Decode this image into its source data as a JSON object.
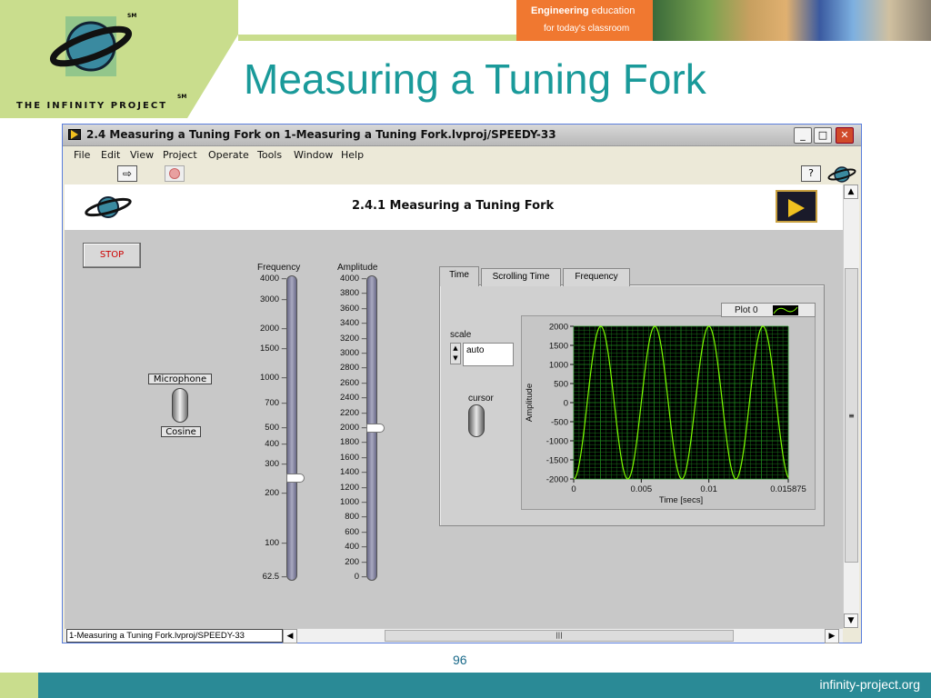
{
  "slide": {
    "title": "Measuring a Tuning Fork",
    "logo_text": "THE INFINITY PROJECT",
    "sm": "SM",
    "brand_engineering": "Engineering",
    "brand_education": "education",
    "brand_tagline": "for today's classroom",
    "page_number": "96",
    "footer_url": "infinity-project.org"
  },
  "window": {
    "title": "2.4 Measuring a Tuning Fork on 1-Measuring a Tuning Fork.lvproj/SPEEDY-33",
    "menu": [
      "File",
      "Edit",
      "View",
      "Project",
      "Operate",
      "Tools",
      "Window",
      "Help"
    ],
    "vi_title": "2.4.1 Measuring a Tuning Fork",
    "status_path": "1-Measuring a Tuning Fork.lvproj/SPEEDY-33"
  },
  "controls": {
    "stop_label": "STOP",
    "source_switch": {
      "top_label": "Microphone",
      "bottom_label": "Cosine"
    },
    "frequency": {
      "label": "Frequency",
      "ticks": [
        "4000",
        "3000",
        "2000",
        "1500",
        "1000",
        "700",
        "500",
        "400",
        "300",
        "200",
        "100",
        "62.5"
      ],
      "value": 250
    },
    "amplitude": {
      "label": "Amplitude",
      "ticks": [
        "4000",
        "3800",
        "3600",
        "3400",
        "3200",
        "3000",
        "2800",
        "2600",
        "2400",
        "2200",
        "2000",
        "1800",
        "1600",
        "1400",
        "1200",
        "1000",
        "800",
        "600",
        "400",
        "200",
        "0"
      ],
      "value": 2000
    },
    "tabs": [
      "Time",
      "Scrolling Time",
      "Frequency"
    ],
    "active_tab": "Time",
    "scale_label": "scale",
    "scale_value": "auto",
    "cursor_label": "cursor"
  },
  "chart_data": {
    "type": "line",
    "legend": "Plot 0",
    "xlabel": "Time [secs]",
    "ylabel": "Amplitude",
    "xlim": [
      0,
      0.015875
    ],
    "ylim": [
      -2000,
      2000
    ],
    "xticks": [
      "0",
      "0.005",
      "0.01",
      "0.015875"
    ],
    "yticks": [
      "2000",
      "1500",
      "1000",
      "500",
      "0",
      "-500",
      "-1000",
      "-1500",
      "-2000"
    ],
    "series": [
      {
        "frequency_hz": 250,
        "amplitude": 2000,
        "color": "#7cfc00"
      }
    ],
    "background": "#000000",
    "grid": true,
    "grid_color": "#1f8a1f"
  }
}
